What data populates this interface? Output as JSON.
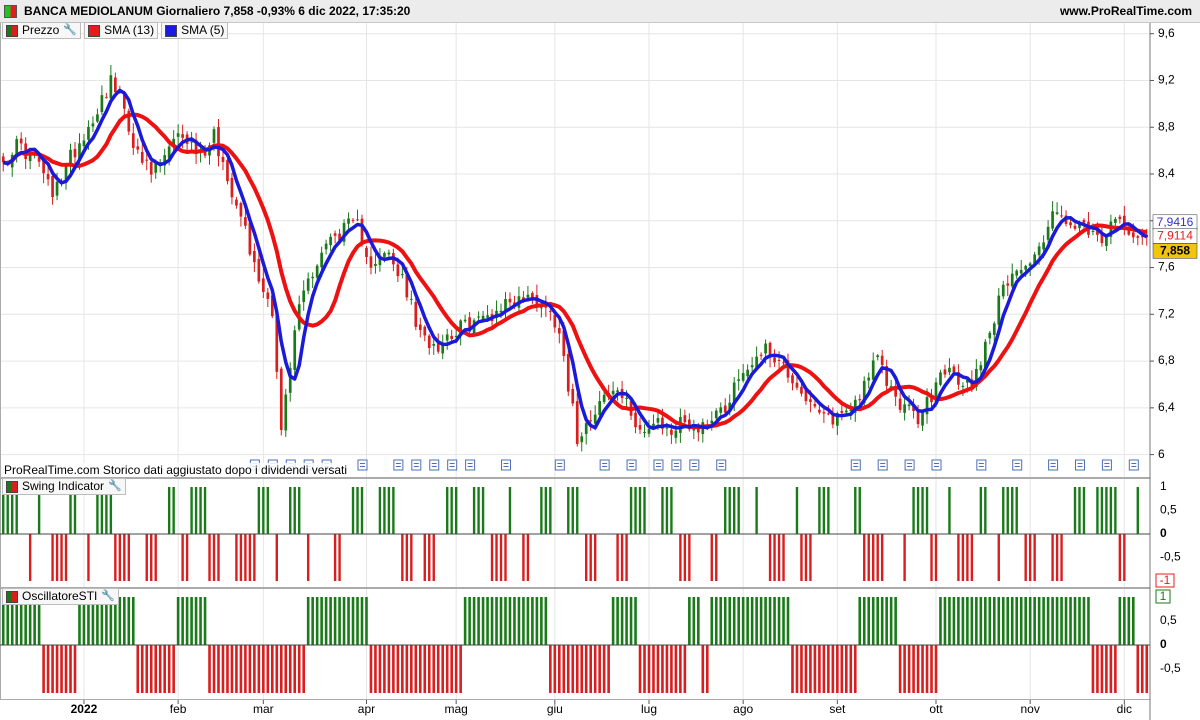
{
  "window": {
    "title": "BANCA MEDIOLANUM Giornaliero 7,858 -0,93% 6 dic 2022, 17:35:20",
    "site": "www.ProRealTime.com"
  },
  "legend": {
    "price": "Prezzo",
    "sma13": "SMA (13)",
    "sma5": "SMA (5)"
  },
  "notes": {
    "history": "ProRealTime.com Storico dati aggiustato dopo i dividendi versati"
  },
  "colors": {
    "up": "#1a7a1a",
    "down": "#d81e1e",
    "sma13": "#ee1111",
    "sma5": "#1a1ad8",
    "grid": "#e6e6e6",
    "border": "#aaaaaa",
    "price_badge": "#f2c50c",
    "sma13_badge": "#e51c1c",
    "sma5_badge": "#3333cc",
    "swing_badge": "#e51c1c",
    "osc_badge": "#1a7a1a"
  },
  "icons": {
    "app": "chart-square-icon",
    "edit": "wrench-icon",
    "dividend": "dividend-note-icon"
  },
  "price_panel": {
    "y_ticks": [
      "9,6",
      "9,2",
      "8,8",
      "8,4",
      "8",
      "7,6",
      "7,2",
      "6,8",
      "6,4",
      "6"
    ],
    "y_values": [
      9.6,
      9.2,
      8.8,
      8.4,
      8.0,
      7.6,
      7.2,
      6.8,
      6.4,
      6.0
    ],
    "ylim": [
      5.8,
      9.7
    ],
    "last_price": "7,858",
    "sma5_last": "7,9416",
    "sma13_last": "7,9114"
  },
  "swing_panel": {
    "name": "Swing Indicator",
    "y_ticks": [
      "1",
      "0,5",
      "0",
      "-0,5"
    ],
    "y_values": [
      1,
      0.5,
      0,
      -0.5
    ],
    "last_value": "-1"
  },
  "osc_panel": {
    "name": "OscillatoreSTI",
    "y_ticks": [
      "0,5",
      "0",
      "-0,5"
    ],
    "y_values": [
      0.5,
      0,
      -0.5
    ],
    "last_value": "1"
  },
  "x_axis": {
    "labels": [
      "2022",
      "feb",
      "mar",
      "apr",
      "mag",
      "giu",
      "lug",
      "ago",
      "set",
      "ott",
      "nov",
      "dic"
    ],
    "bar_index": [
      18,
      39,
      58,
      81,
      101,
      123,
      144,
      165,
      186,
      208,
      229,
      250
    ]
  },
  "chart_data": {
    "type": "candlestick",
    "series": [
      {
        "name": "Prezzo"
      },
      {
        "name": "SMA (13)"
      },
      {
        "name": "SMA (5)"
      }
    ],
    "anchors_close": [
      [
        0,
        8.5
      ],
      [
        3,
        8.65
      ],
      [
        8,
        8.5
      ],
      [
        11,
        8.2
      ],
      [
        15,
        8.55
      ],
      [
        19,
        8.8
      ],
      [
        22,
        9.05
      ],
      [
        24,
        9.2
      ],
      [
        27,
        8.95
      ],
      [
        30,
        8.55
      ],
      [
        33,
        8.4
      ],
      [
        36,
        8.55
      ],
      [
        40,
        8.75
      ],
      [
        44,
        8.55
      ],
      [
        47,
        8.75
      ],
      [
        50,
        8.35
      ],
      [
        53,
        8.1
      ],
      [
        56,
        7.6
      ],
      [
        60,
        7.25
      ],
      [
        62,
        6.2
      ],
      [
        64,
        6.75
      ],
      [
        66,
        7.3
      ],
      [
        68,
        7.5
      ],
      [
        72,
        7.8
      ],
      [
        75,
        7.9
      ],
      [
        77,
        7.95
      ],
      [
        79,
        7.95
      ],
      [
        82,
        7.65
      ],
      [
        86,
        7.7
      ],
      [
        90,
        7.4
      ],
      [
        93,
        7.0
      ],
      [
        97,
        6.95
      ],
      [
        100,
        7.05
      ],
      [
        103,
        7.1
      ],
      [
        106,
        7.15
      ],
      [
        109,
        7.2
      ],
      [
        112,
        7.3
      ],
      [
        116,
        7.35
      ],
      [
        120,
        7.3
      ],
      [
        124,
        7.1
      ],
      [
        126,
        6.6
      ],
      [
        128,
        6.15
      ],
      [
        131,
        6.35
      ],
      [
        134,
        6.5
      ],
      [
        137,
        6.55
      ],
      [
        140,
        6.35
      ],
      [
        143,
        6.2
      ],
      [
        146,
        6.25
      ],
      [
        149,
        6.2
      ],
      [
        152,
        6.3
      ],
      [
        155,
        6.2
      ],
      [
        158,
        6.35
      ],
      [
        161,
        6.4
      ],
      [
        163,
        6.6
      ],
      [
        166,
        6.75
      ],
      [
        169,
        6.9
      ],
      [
        172,
        6.85
      ],
      [
        175,
        6.7
      ],
      [
        178,
        6.55
      ],
      [
        181,
        6.35
      ],
      [
        184,
        6.3
      ],
      [
        187,
        6.35
      ],
      [
        190,
        6.45
      ],
      [
        193,
        6.7
      ],
      [
        195,
        6.8
      ],
      [
        198,
        6.55
      ],
      [
        201,
        6.4
      ],
      [
        204,
        6.3
      ],
      [
        207,
        6.5
      ],
      [
        210,
        6.75
      ],
      [
        213,
        6.6
      ],
      [
        216,
        6.6
      ],
      [
        219,
        6.95
      ],
      [
        222,
        7.3
      ],
      [
        225,
        7.6
      ],
      [
        228,
        7.6
      ],
      [
        231,
        7.75
      ],
      [
        234,
        8.1
      ],
      [
        237,
        7.95
      ],
      [
        240,
        7.95
      ],
      [
        243,
        7.85
      ],
      [
        246,
        7.85
      ],
      [
        248,
        8.0
      ],
      [
        251,
        7.95
      ],
      [
        255,
        7.858
      ]
    ],
    "bar_count": 256,
    "seed": 17
  }
}
